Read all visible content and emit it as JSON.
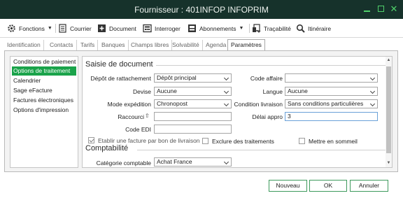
{
  "window": {
    "title": "Fournisseur : 401INFOP INFOPRIM"
  },
  "toolbar": {
    "items": [
      {
        "label": "Fonctions",
        "icon": "gear-icon"
      },
      {
        "label": "Courrier",
        "icon": "document-icon"
      },
      {
        "label": "Document",
        "icon": "add-document-icon"
      },
      {
        "label": "Interroger",
        "icon": "calculator-icon"
      },
      {
        "label": "Abonnements",
        "icon": "subscription-icon"
      },
      {
        "label": "Traçabilité",
        "icon": "traceability-icon"
      },
      {
        "label": "Itinéraire",
        "icon": "search-icon"
      }
    ]
  },
  "tabs": [
    {
      "label": "Identification"
    },
    {
      "label": "Contacts"
    },
    {
      "label": "Tarifs"
    },
    {
      "label": "Banques"
    },
    {
      "label": "Champs libres"
    },
    {
      "label": "Solvabilité"
    },
    {
      "label": "Agenda"
    },
    {
      "label": "Paramètres",
      "active": true
    }
  ],
  "leftnav": {
    "items": [
      {
        "label": "Conditions de paiement"
      },
      {
        "label": "Options de traitement",
        "selected": true
      },
      {
        "label": "Calendrier"
      },
      {
        "label": "Sage eFacture"
      },
      {
        "label": "Factures électroniques"
      },
      {
        "label": "Options d'impression"
      }
    ]
  },
  "saisie": {
    "title": "Saisie de document",
    "depot_label": "Dépôt de rattachement",
    "depot_value": "Dépôt principal",
    "devise_label": "Devise",
    "devise_value": "Aucune",
    "mode_label": "Mode expédition",
    "mode_value": "Chronopost",
    "raccourci_label": "Raccourci",
    "raccourci_value": "",
    "code_edi_label": "Code EDI",
    "code_edi_value": "",
    "code_affaire_label": "Code affaire",
    "code_affaire_value": "",
    "langue_label": "Langue",
    "langue_value": "Aucune",
    "condition_label": "Condition livraison",
    "condition_value": "Sans conditions particulières",
    "delai_label": "Délai appro",
    "delai_value": "3",
    "etablir_label": "Etablir une facture par bon de livraison",
    "exclure_label": "Exclure des traitements",
    "mettre_label": "Mettre en sommeil"
  },
  "comptabilite": {
    "title": "Comptabilité",
    "categorie_label": "Catégorie comptable",
    "categorie_value": "Achat France"
  },
  "footer": {
    "nouveau": "Nouveau",
    "ok": "OK",
    "annuler": "Annuler"
  },
  "colors": {
    "titlebar": "#16322b",
    "accent": "#1aa34a",
    "window_controls": "#4fd06a"
  }
}
